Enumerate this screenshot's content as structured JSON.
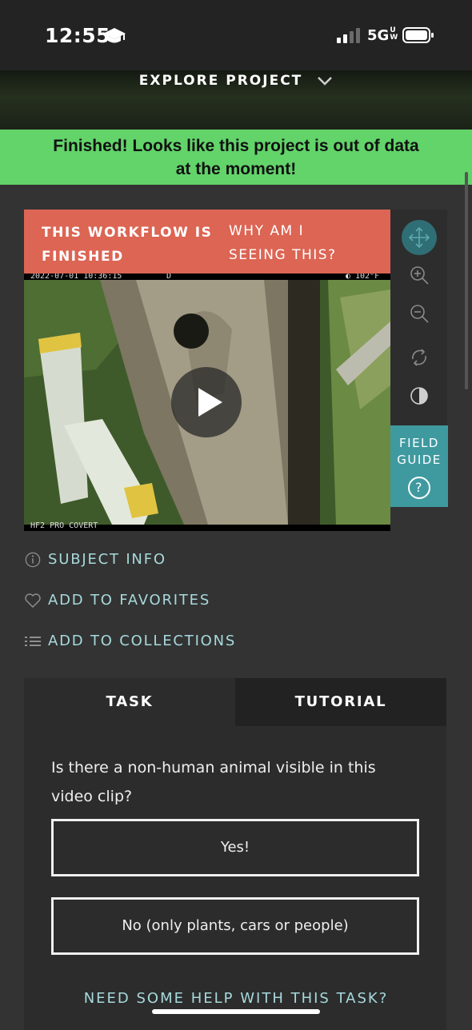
{
  "status_bar": {
    "time": "12:55",
    "network": "5G",
    "network_suffix": "UW"
  },
  "header": {
    "explore_label": "EXPLORE PROJECT"
  },
  "banner": {
    "line1": "Finished! Looks like this project is out of data",
    "line2": "at the moment!"
  },
  "workflow_notice": {
    "finished_line1": "THIS WORKFLOW IS",
    "finished_line2": "FINISHED",
    "why_line1": "WHY AM I",
    "why_line2": "SEEING THIS?"
  },
  "video": {
    "timestamp": "2022-07-01 10:36:15",
    "mode": "D",
    "temperature": "102°F",
    "camera_model": "HF2 PRO COVERT"
  },
  "tools": [
    "move-icon",
    "zoom-in-icon",
    "zoom-out-icon",
    "rotate-icon",
    "invert-icon"
  ],
  "field_guide": {
    "line1": "FIELD",
    "line2": "GUIDE",
    "icon": "?"
  },
  "meta_links": {
    "subject_info": "SUBJECT INFO",
    "favorites": "ADD TO FAVORITES",
    "collections": "ADD TO COLLECTIONS"
  },
  "task_panel": {
    "tabs": [
      "TASK",
      "TUTORIAL"
    ],
    "question_line1": "Is there a non-human animal visible in this",
    "question_line2": "video clip?",
    "answers": [
      "Yes!",
      "No (only plants, cars or people)"
    ],
    "help_link": "NEED SOME HELP WITH THIS TASK?"
  },
  "colors": {
    "banner_green": "#62d46a",
    "finished_red": "#dc6554",
    "field_guide_teal": "#3f9aa0",
    "link_teal": "#a7d9dc",
    "background": "#333333"
  }
}
